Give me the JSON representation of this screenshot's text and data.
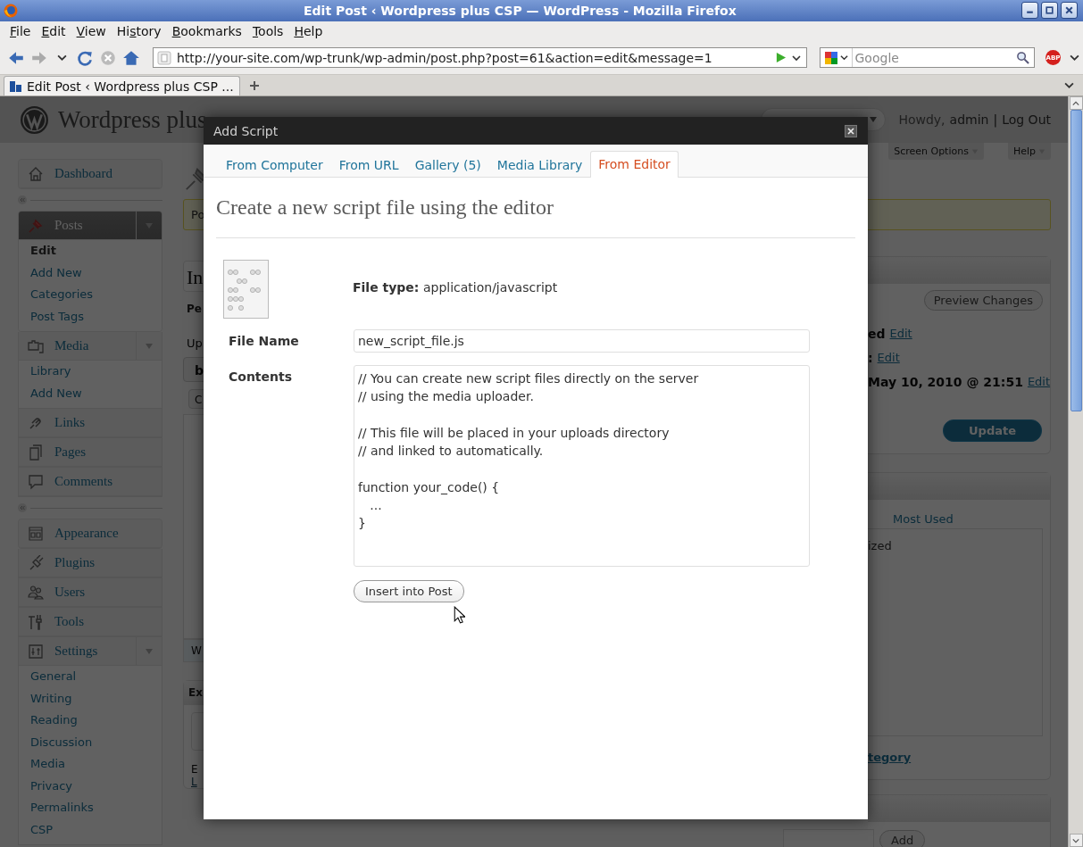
{
  "window": {
    "title": "Edit Post ‹ Wordpress plus CSP — WordPress - Mozilla Firefox"
  },
  "menu_bar": [
    {
      "key": "F",
      "after": "ile"
    },
    {
      "key": "E",
      "after": "dit"
    },
    {
      "key": "V",
      "after": "iew"
    },
    {
      "before": "Hi",
      "key": "s",
      "after": "tory"
    },
    {
      "key": "B",
      "after": "ookmarks"
    },
    {
      "key": "T",
      "after": "ools"
    },
    {
      "key": "H",
      "after": "elp"
    }
  ],
  "toolbar": {
    "url": "http://your-site.com/wp-trunk/wp-admin/post.php?post=61&action=edit&message=1",
    "search_placeholder": "Google",
    "adblock_badge": "ABP"
  },
  "tabs": [
    {
      "title": "Edit Post ‹ Wordpress plus CSP ...",
      "selected": true
    }
  ],
  "wp_header": {
    "site_title": "Wordpress plus",
    "greeting": "Howdy,",
    "user": "admin",
    "separator": "|",
    "logout": "Log Out"
  },
  "sidebar": [
    {
      "kind": "menu",
      "label": "Dashboard",
      "selected": false
    },
    {
      "kind": "separator"
    },
    {
      "kind": "menu",
      "label": "Posts",
      "selected": true,
      "expanded": true,
      "children": [
        {
          "label": "Edit",
          "selected": true
        },
        {
          "label": "Add New",
          "selected": false
        },
        {
          "label": "Categories",
          "selected": false
        },
        {
          "label": "Post Tags",
          "selected": false
        }
      ]
    },
    {
      "kind": "menu",
      "label": "Media",
      "selected": false,
      "expanded": true,
      "children": [
        {
          "label": "Library",
          "selected": false
        },
        {
          "label": "Add New",
          "selected": false
        }
      ]
    },
    {
      "kind": "menu",
      "label": "Links",
      "selected": false
    },
    {
      "kind": "menu",
      "label": "Pages",
      "selected": false
    },
    {
      "kind": "menu",
      "label": "Comments",
      "selected": false
    },
    {
      "kind": "separator"
    },
    {
      "kind": "menu",
      "label": "Appearance",
      "selected": false
    },
    {
      "kind": "menu",
      "label": "Plugins",
      "selected": false
    },
    {
      "kind": "menu",
      "label": "Users",
      "selected": false
    },
    {
      "kind": "menu",
      "label": "Tools",
      "selected": false
    },
    {
      "kind": "menu",
      "label": "Settings",
      "selected": false,
      "expanded": true,
      "children": [
        {
          "label": "General",
          "selected": false
        },
        {
          "label": "Writing",
          "selected": false
        },
        {
          "label": "Reading",
          "selected": false
        },
        {
          "label": "Discussion",
          "selected": false
        },
        {
          "label": "Media",
          "selected": false
        },
        {
          "label": "Privacy",
          "selected": false
        },
        {
          "label": "Permalinks",
          "selected": false
        },
        {
          "label": "CSP",
          "selected": false
        }
      ]
    }
  ],
  "screen_meta": [
    "Screen Options",
    "Help"
  ],
  "notice_fragment": "Po",
  "left_fragments": {
    "title": "In",
    "permalink": "Pe",
    "upload": "Up",
    "button_1": "b",
    "button_2": "C",
    "status": "W",
    "box_heading": "Ex",
    "text": "E",
    "link": "L"
  },
  "publish_box": {
    "preview": "Preview Changes",
    "rows": [
      {
        "label": "ed",
        "link": "Edit"
      },
      {
        "label": ":",
        "link": "Edit"
      },
      {
        "label": "May 10, 2010 @ 21:51",
        "link": "Edit"
      }
    ],
    "update": "Update"
  },
  "categories_box": {
    "tab": "Most Used",
    "item": "ized",
    "link": "tegory"
  },
  "tags_box": {
    "button": "Add"
  },
  "dialog": {
    "title": "Add Script",
    "tabs": [
      {
        "label": "From Computer",
        "selected": false
      },
      {
        "label": "From URL",
        "selected": false
      },
      {
        "label": "Gallery (5)",
        "selected": false
      },
      {
        "label": "Media Library",
        "selected": false
      },
      {
        "label": "From Editor",
        "selected": true
      }
    ],
    "heading": "Create a new script file using the editor",
    "file_type": "**File type:** application/javascript",
    "fields": [
      {
        "kind": "input",
        "label": "File Name",
        "value": "new_script_file.js"
      },
      {
        "kind": "textarea",
        "label": "Contents",
        "value": "// You can create new script files directly on the server\n// using the media uploader.\n\n// This file will be placed in your uploads directory\n// and linked to automatically.\n\nfunction your_code() {\n   ...\n}"
      }
    ],
    "submit": "Insert into Post"
  }
}
